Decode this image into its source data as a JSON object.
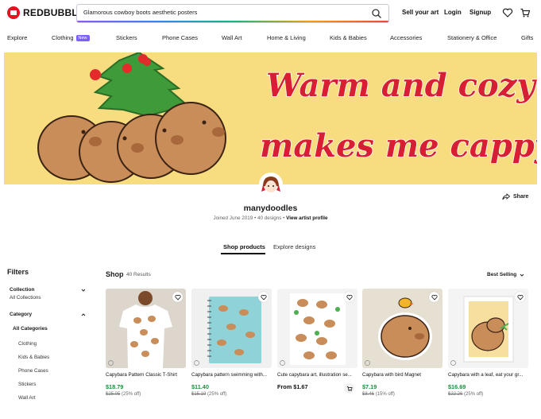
{
  "header": {
    "logo_text": "REDBUBBLE",
    "search_value": "Glamorous cowboy boots aesthetic posters",
    "sell_label": "Sell your art",
    "login_label": "Login",
    "signup_label": "Signup",
    "heart_icon": "heart-icon",
    "cart_icon": "cart-icon"
  },
  "categories": {
    "explore": "Explore",
    "clothing": "Clothing",
    "new_badge": "New",
    "stickers": "Stickers",
    "phone_cases": "Phone Cases",
    "wall_art": "Wall Art",
    "home_living": "Home & Living",
    "kids_babies": "Kids & Babies",
    "accessories": "Accessories",
    "stationery": "Stationery & Office",
    "gifts": "Gifts"
  },
  "banner": {
    "line1": "Warm and cozy",
    "line2": "makes me cappy!",
    "bg_color": "#f8dc80",
    "text_color": "#d81e32"
  },
  "artist": {
    "name": "manydoodles",
    "joined": "Joined June 2019",
    "designs": "40 designs",
    "view_profile": "View artist profile",
    "share_label": "Share"
  },
  "tabs": {
    "shop_products": "Shop products",
    "explore_designs": "Explore designs"
  },
  "filters": {
    "title": "Filters",
    "collection_label": "Collection",
    "collection_value": "All Collections",
    "category_label": "Category",
    "all_categories": "All Categories",
    "items": [
      "Clothing",
      "Kids & Babies",
      "Phone Cases",
      "Stickers",
      "Wall Art"
    ]
  },
  "shop": {
    "title": "Shop",
    "count": "40 Results",
    "sort_label": "Best Selling"
  },
  "products": [
    {
      "title": "Capybara Pattern Classic T-Shirt",
      "price": "$18.79",
      "old_price": "$25.05",
      "discount": "(25% off)"
    },
    {
      "title": "Capybara pattern swimming with...",
      "price": "$11.40",
      "old_price": "$15.19",
      "discount": "(25% off)"
    },
    {
      "title": "Cute capybara art, illustration se...",
      "price": "From $1.67",
      "old_price": "",
      "discount": ""
    },
    {
      "title": "Capybara with bird Magnet",
      "price": "$7.19",
      "old_price": "$8.46",
      "discount": "(15% off)"
    },
    {
      "title": "Capybara with a leaf, eat your gr...",
      "price": "$16.69",
      "old_price": "$22.26",
      "discount": "(25% off)"
    }
  ]
}
